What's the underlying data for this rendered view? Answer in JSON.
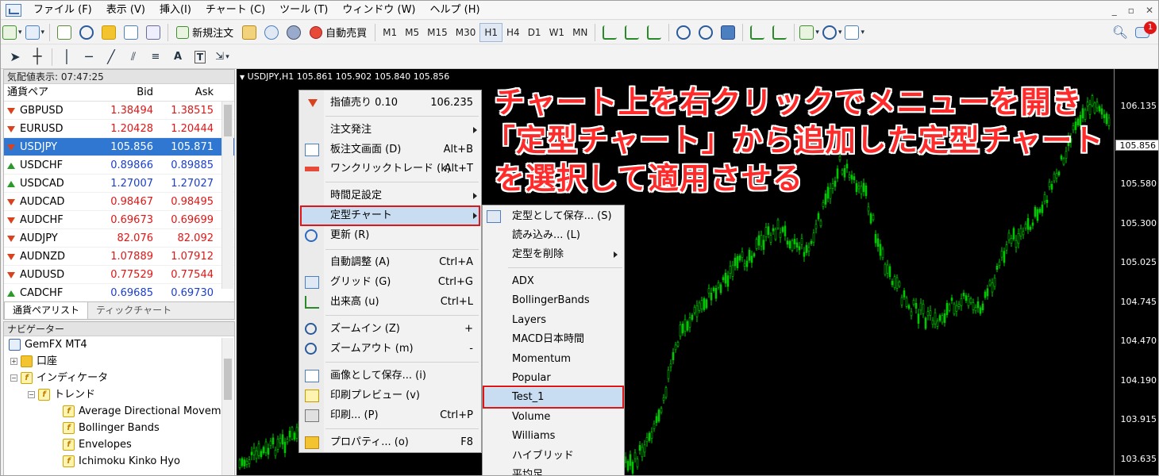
{
  "menubar": {
    "items": [
      "ファイル (F)",
      "表示 (V)",
      "挿入(I)",
      "チャート (C)",
      "ツール (T)",
      "ウィンドウ (W)",
      "ヘルプ (H)"
    ],
    "win_min": "_",
    "win_restore": "▫",
    "win_close": "✕"
  },
  "toolbar": {
    "new_order": "新規注文",
    "auto_trade": "自動売買",
    "timeframes": [
      "M1",
      "M5",
      "M15",
      "M30",
      "H1",
      "H4",
      "D1",
      "W1",
      "MN"
    ],
    "active_timeframe": "H1",
    "notification_count": "1"
  },
  "market_watch": {
    "title": "気配値表示: 07:47:25",
    "col_symbol": "通貨ペア",
    "col_bid": "Bid",
    "col_ask": "Ask",
    "rows": [
      {
        "symbol": "GBPUSD",
        "bid": "1.38494",
        "ask": "1.38515",
        "dir": "down",
        "color": "red"
      },
      {
        "symbol": "EURUSD",
        "bid": "1.20428",
        "ask": "1.20444",
        "dir": "down",
        "color": "red"
      },
      {
        "symbol": "USDJPY",
        "bid": "105.856",
        "ask": "105.871",
        "dir": "down",
        "color": "red"
      },
      {
        "symbol": "USDCHF",
        "bid": "0.89866",
        "ask": "0.89885",
        "dir": "up",
        "color": "blue"
      },
      {
        "symbol": "USDCAD",
        "bid": "1.27007",
        "ask": "1.27027",
        "dir": "up",
        "color": "blue"
      },
      {
        "symbol": "AUDCAD",
        "bid": "0.98467",
        "ask": "0.98495",
        "dir": "down",
        "color": "red"
      },
      {
        "symbol": "AUDCHF",
        "bid": "0.69673",
        "ask": "0.69699",
        "dir": "down",
        "color": "red"
      },
      {
        "symbol": "AUDJPY",
        "bid": "82.076",
        "ask": "82.092",
        "dir": "down",
        "color": "red"
      },
      {
        "symbol": "AUDNZD",
        "bid": "1.07889",
        "ask": "1.07912",
        "dir": "down",
        "color": "red"
      },
      {
        "symbol": "AUDUSD",
        "bid": "0.77529",
        "ask": "0.77544",
        "dir": "down",
        "color": "red"
      },
      {
        "symbol": "CADCHF",
        "bid": "0.69685",
        "ask": "0.69730",
        "dir": "up",
        "color": "blue"
      }
    ],
    "selected_index": 2,
    "tabs": [
      "通貨ペアリスト",
      "ティックチャート"
    ]
  },
  "navigator": {
    "title": "ナビゲーター",
    "root": "GemFX MT4",
    "accounts": "口座",
    "indicators": "インディケータ",
    "trend": "トレンド",
    "items": [
      "Average Directional Moveme",
      "Bollinger Bands",
      "Envelopes",
      "Ichimoku Kinko Hyo"
    ]
  },
  "chart": {
    "header": "USDJPY,H1  105.861 105.902 105.840 105.856",
    "price_labels": [
      "106.135",
      "105.580",
      "105.300",
      "105.025",
      "104.745",
      "104.470",
      "104.190",
      "103.915",
      "103.635"
    ],
    "current_price": "105.856",
    "colors": {
      "background": "#000000",
      "candles": "#00c800",
      "axis": "#ffffff"
    }
  },
  "annotation": {
    "line1": "チャート上を右クリックでメニューを開き",
    "line2": "「定型チャート」から追加した定型チャート",
    "line3": "を選択して適用させる",
    "color": "#ff2a2a"
  },
  "context_menu": {
    "sell": "指値売り 0.10",
    "sell_price": "106.235",
    "order": "注文発注",
    "board": "板注文画面 (D)",
    "board_sc": "Alt+B",
    "oneclick": "ワンクリックトレード (k)",
    "oneclick_sc": "Alt+T",
    "timeframe": "時間足設定",
    "template": "定型チャート",
    "refresh": "更新 (R)",
    "autoscale": "自動調整 (A)",
    "autoscale_sc": "Ctrl+A",
    "grid": "グリッド (G)",
    "grid_sc": "Ctrl+G",
    "volume": "出来高 (u)",
    "volume_sc": "Ctrl+L",
    "zoomin": "ズームイン (Z)",
    "zoomin_sc": "+",
    "zoomout": "ズームアウト (m)",
    "zoomout_sc": "-",
    "save_image": "画像として保存... (i)",
    "print_preview": "印刷プレビュー (v)",
    "print": "印刷... (P)",
    "print_sc": "Ctrl+P",
    "properties": "プロパティ... (o)",
    "properties_sc": "F8"
  },
  "template_menu": {
    "save": "定型として保存... (S)",
    "load": "読み込み... (L)",
    "delete": "定型を削除",
    "templates": [
      "ADX",
      "BollingerBands",
      "Layers",
      "MACD日本時間",
      "Momentum",
      "Popular",
      "Test_1",
      "Volume",
      "Williams",
      "ハイブリッド",
      "平均足"
    ],
    "selected": "Test_1"
  }
}
